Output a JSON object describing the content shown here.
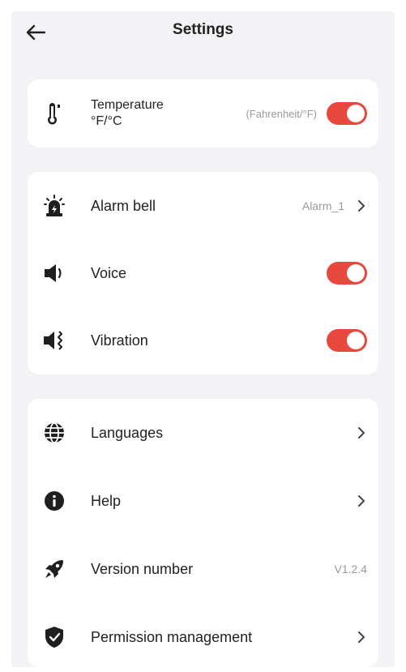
{
  "header": {
    "title": "Settings"
  },
  "temperature": {
    "label_line1": "Temperature",
    "label_line2": "°F/°C",
    "value": "(Fahrenheit/°F)",
    "enabled": true
  },
  "alarm": {
    "label": "Alarm bell",
    "value": "Alarm_1"
  },
  "voice": {
    "label": "Voice",
    "enabled": true
  },
  "vibration": {
    "label": "Vibration",
    "enabled": true
  },
  "general": {
    "languages_label": "Languages",
    "help_label": "Help",
    "version_label": "Version number",
    "version_value": "V1.2.4",
    "permission_label": "Permission management"
  },
  "colors": {
    "accent": "#e8493f",
    "background": "#f3f3f5",
    "card": "#ffffff"
  },
  "icons": {
    "back": "arrow-left-icon",
    "temperature": "thermometer-icon",
    "alarm": "siren-icon",
    "voice": "speaker-icon",
    "vibration": "vibration-icon",
    "languages": "globe-icon",
    "help": "info-icon",
    "version": "rocket-icon",
    "permission": "shield-check-icon"
  }
}
